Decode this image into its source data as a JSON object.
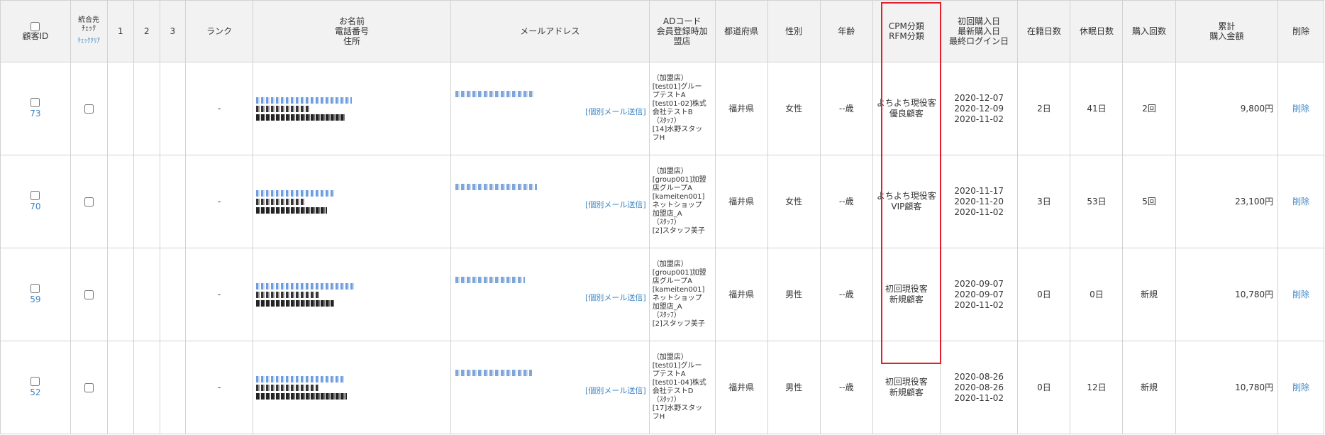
{
  "header": {
    "customer_id": "顧客ID",
    "merge_check": "統合先\nﾁｪｯｸ",
    "check_clear": "ﾁｪｯｸｸﾘｱ",
    "col1": "1",
    "col2": "2",
    "col3": "3",
    "rank": "ランク",
    "name_block": "お名前\n電話番号\n住所",
    "email": "メールアドレス",
    "adcode": "ADコード\n会員登録時加\n盟店",
    "prefecture": "都道府県",
    "gender": "性別",
    "age": "年齢",
    "cpm_rfm": "CPM分類\nRFM分類",
    "dates": "初回購入日\n最新購入日\n最終ログイン日",
    "days_enrolled": "在籍日数",
    "days_dormant": "休眠日数",
    "purchase_count": "購入回数",
    "total_amount": "累計\n購入金額",
    "delete": "削除"
  },
  "rows": [
    {
      "id": "73",
      "rank": "-",
      "send_mail": "[個別メール送信]",
      "ad_block": "（加盟店）\n[test01]グルー\nプテストA\n[test01-02]株式\n会社テストB\n（ｽﾀｯﾌ）\n[14]水野スタッ\nフH",
      "prefecture": "福井県",
      "gender": "女性",
      "age": "--歳",
      "classification": "よちよち現役客\n優良顧客",
      "dates": "2020-12-07\n2020-12-09\n2020-11-02",
      "days_enrolled": "2日",
      "days_dormant": "41日",
      "purchase_count": "2回",
      "total": "9,800円",
      "delete": "削除"
    },
    {
      "id": "70",
      "rank": "-",
      "send_mail": "[個別メール送信]",
      "ad_block": "（加盟店）\n[group001]加盟\n店グループA\n[kameiten001]\nネットショップ\n加盟店_A\n（ｽﾀｯﾌ）\n[2]スタッフ美子",
      "prefecture": "福井県",
      "gender": "女性",
      "age": "--歳",
      "classification": "よちよち現役客\nVIP顧客",
      "dates": "2020-11-17\n2020-11-20\n2020-11-02",
      "days_enrolled": "3日",
      "days_dormant": "53日",
      "purchase_count": "5回",
      "total": "23,100円",
      "delete": "削除"
    },
    {
      "id": "59",
      "rank": "-",
      "send_mail": "[個別メール送信]",
      "ad_block": "（加盟店）\n[group001]加盟\n店グループA\n[kameiten001]\nネットショップ\n加盟店_A\n（ｽﾀｯﾌ）\n[2]スタッフ美子",
      "prefecture": "福井県",
      "gender": "男性",
      "age": "--歳",
      "classification": "初回現役客\n新規顧客",
      "dates": "2020-09-07\n2020-09-07\n2020-11-02",
      "days_enrolled": "0日",
      "days_dormant": "0日",
      "purchase_count": "新規",
      "total": "10,780円",
      "delete": "削除"
    },
    {
      "id": "52",
      "rank": "-",
      "send_mail": "[個別メール送信]",
      "ad_block": "（加盟店）\n[test01]グルー\nプテストA\n[test01-04]株式\n会社テストD\n（ｽﾀｯﾌ）\n[17]水野スタッ\nフH",
      "prefecture": "福井県",
      "gender": "男性",
      "age": "--歳",
      "classification": "初回現役客\n新規顧客",
      "dates": "2020-08-26\n2020-08-26\n2020-11-02",
      "days_enrolled": "0日",
      "days_dormant": "12日",
      "purchase_count": "新規",
      "total": "10,780円",
      "delete": "削除"
    }
  ],
  "colors": {
    "link": "#3b86c6",
    "highlight_border": "#e0202e",
    "header_bg": "#f2f2f2",
    "border": "#d2d2d2"
  }
}
